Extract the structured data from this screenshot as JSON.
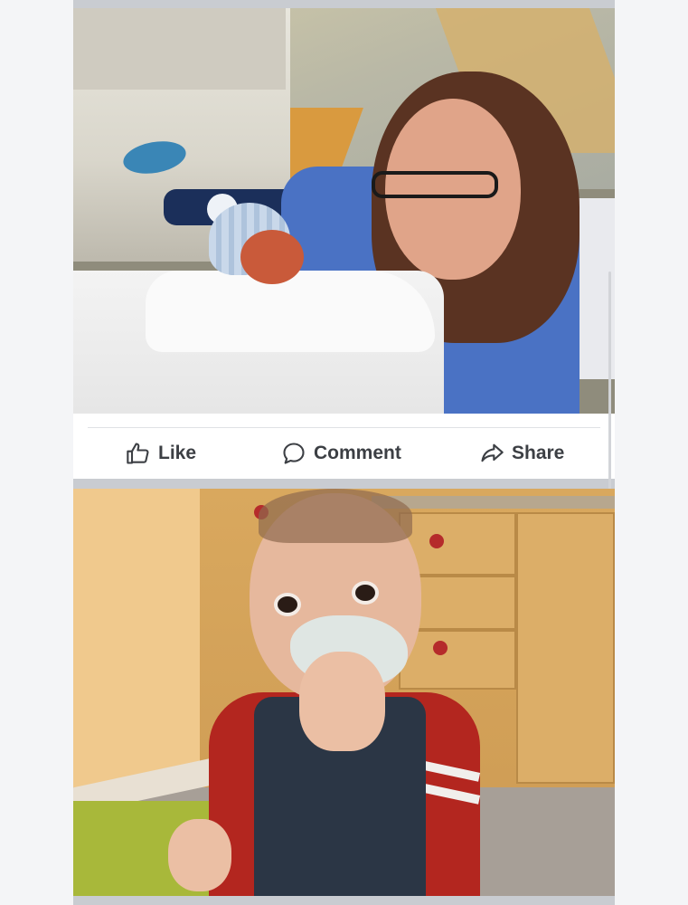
{
  "post": {
    "photo_top": {
      "alt_name": "mother-and-newborn-photo"
    },
    "actions": {
      "like_label": "Like",
      "comment_label": "Comment",
      "share_label": "Share"
    },
    "photo_bottom": {
      "alt_name": "toddler-eating-cake-photo"
    }
  },
  "icons": {
    "like": "thumbs-up-icon",
    "comment": "speech-bubble-icon",
    "share": "share-arrow-icon"
  },
  "colors": {
    "action_text": "#3c3f44",
    "divider": "#dfe1e5",
    "separator": "#c9ccd1"
  }
}
